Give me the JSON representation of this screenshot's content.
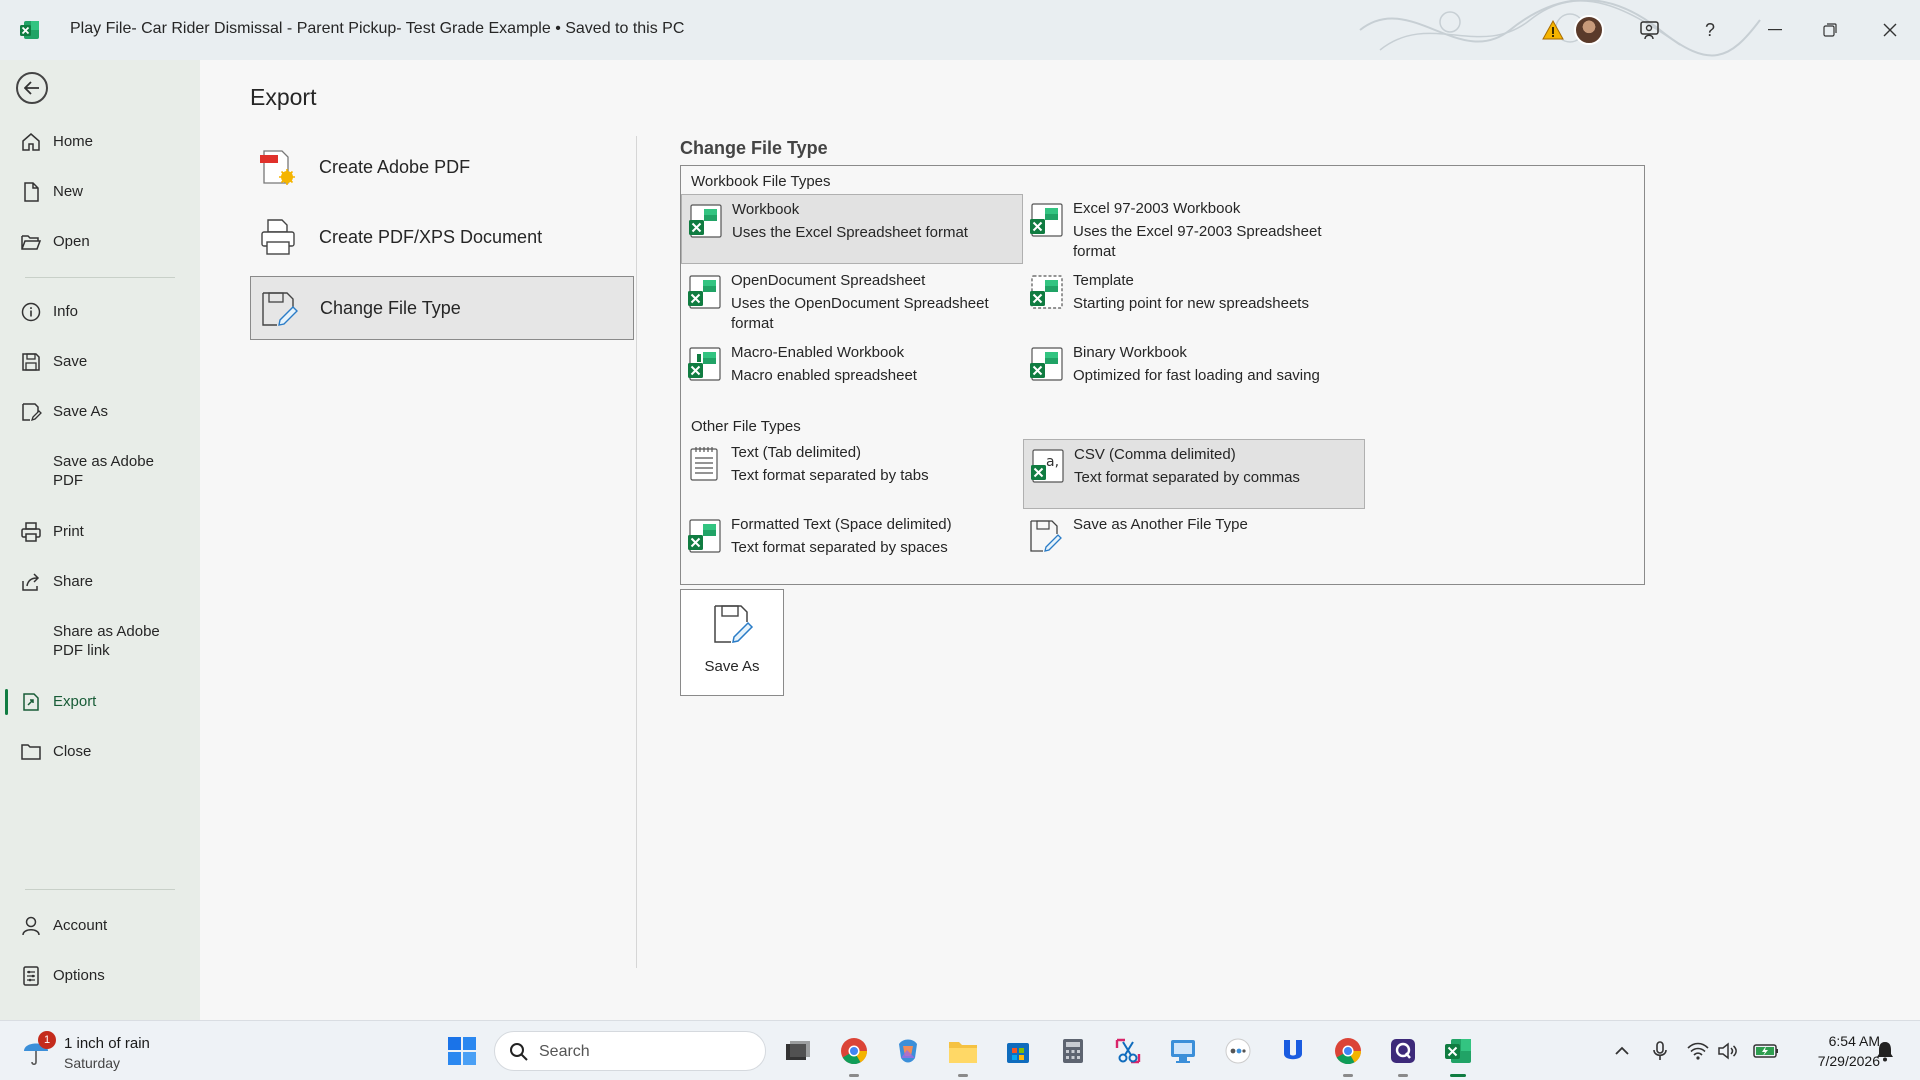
{
  "window": {
    "title": "Play File- Car Rider Dismissal - Parent Pickup- Test Grade Example  •  Saved to this PC"
  },
  "sidebar": {
    "items": [
      {
        "label": "Home",
        "icon": "home-icon"
      },
      {
        "label": "New",
        "icon": "new-document-icon"
      },
      {
        "label": "Open",
        "icon": "folder-open-icon"
      },
      {
        "label": "Info",
        "icon": "info-icon"
      },
      {
        "label": "Save",
        "icon": "save-icon"
      },
      {
        "label": "Save As",
        "icon": "save-as-icon"
      },
      {
        "label": "Save as Adobe PDF",
        "icon": ""
      },
      {
        "label": "Print",
        "icon": "print-icon"
      },
      {
        "label": "Share",
        "icon": "share-icon"
      },
      {
        "label": "Share as Adobe PDF link",
        "icon": ""
      },
      {
        "label": "Export",
        "icon": "export-icon",
        "active": true
      },
      {
        "label": "Close",
        "icon": "close-folder-icon"
      }
    ],
    "bottom_items": [
      {
        "label": "Account",
        "icon": "account-icon"
      },
      {
        "label": "Options",
        "icon": "options-icon"
      }
    ]
  },
  "export": {
    "title": "Export",
    "options": [
      {
        "label": "Create Adobe PDF",
        "icon": "adobe-pdf-icon"
      },
      {
        "label": "Create PDF/XPS Document",
        "icon": "pdf-xps-icon"
      },
      {
        "label": "Change File Type",
        "icon": "change-file-type-icon",
        "selected": true
      }
    ]
  },
  "change_file_type": {
    "title": "Change File Type",
    "workbook_group": "Workbook File Types",
    "other_group": "Other File Types",
    "workbook_types": [
      {
        "name": "Workbook",
        "desc": "Uses the Excel Spreadsheet format",
        "icon": "excel-workbook-icon",
        "selected": true
      },
      {
        "name": "Excel 97-2003 Workbook",
        "desc": "Uses the Excel 97-2003 Spreadsheet format",
        "icon": "excel-97-workbook-icon"
      },
      {
        "name": "OpenDocument Spreadsheet",
        "desc": "Uses the OpenDocument Spreadsheet format",
        "icon": "opendocument-icon"
      },
      {
        "name": "Template",
        "desc": "Starting point for new spreadsheets",
        "icon": "template-icon"
      },
      {
        "name": "Macro-Enabled Workbook",
        "desc": "Macro enabled spreadsheet",
        "icon": "macro-workbook-icon"
      },
      {
        "name": "Binary Workbook",
        "desc": "Optimized for fast loading and saving",
        "icon": "binary-workbook-icon"
      }
    ],
    "other_types": [
      {
        "name": "Text (Tab delimited)",
        "desc": "Text format separated by tabs",
        "icon": "text-file-icon"
      },
      {
        "name": "CSV (Comma delimited)",
        "desc": "Text format separated by commas",
        "icon": "csv-icon",
        "hovered": true
      },
      {
        "name": "Formatted Text (Space delimited)",
        "desc": "Text format separated by spaces",
        "icon": "formatted-text-icon"
      },
      {
        "name": "Save as Another File Type",
        "desc": "",
        "icon": "another-file-type-icon"
      }
    ],
    "save_as_label": "Save As"
  },
  "taskbar": {
    "weather_text": "1 inch of rain",
    "weather_day": "Saturday",
    "weather_badge": "1",
    "search_label": "Search",
    "time": "6:54 AM",
    "date": "7/29/2026"
  },
  "colors": {
    "excel_green": "#107c41",
    "accent_dark_green": "#185c37"
  }
}
